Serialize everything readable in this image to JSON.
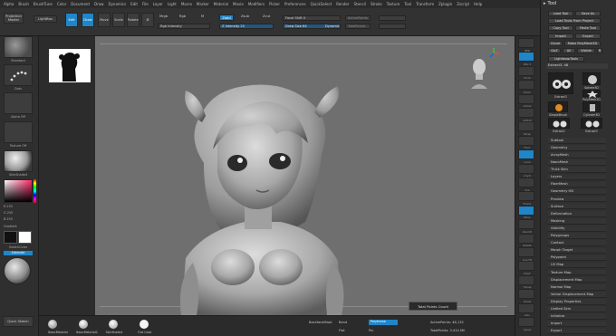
{
  "menu": [
    "Alpha",
    "Brush",
    "BrushTune",
    "Color",
    "Document",
    "Draw",
    "Dynamics",
    "Edit",
    "File",
    "Layer",
    "Light",
    "Macro",
    "Marker",
    "Material",
    "Movie",
    "Modifiers",
    "Picker",
    "Preferences",
    "QuickSelect",
    "Render",
    "Stencil",
    "Stroke",
    "Texture",
    "Tool",
    "Transform",
    "Zplugin",
    "Zscript",
    "Help"
  ],
  "shelf": {
    "projection_master": "Projection Master",
    "lightbox": "LightBox",
    "edit": "Edit",
    "draw": "Draw",
    "move": "Move",
    "scale": "Scale",
    "rotate": "Rotate",
    "mrgb": "Mrgb",
    "rgb": "Rgb",
    "m": "M",
    "zadd": "Zadd",
    "zsub": "Zsub",
    "zcut": "Zcut",
    "rgb_intensity": "Rgb Intensity",
    "z_intensity": "Z Intensity 25",
    "focal_shift": "Focal Shift 0",
    "draw_size": "Draw Size 64",
    "dynamic": "Dynamic",
    "active_points": "ActivePoints",
    "total_points": "TotalPoints"
  },
  "left_tray": {
    "alpha": "Standard",
    "stroke": "Dots",
    "alpha_off": "Alpha Off",
    "texture_off": "Texture Off",
    "material": "SkinShade4",
    "r": "R 255",
    "g": "G 255",
    "b": "B 255",
    "gradient": "Gradient",
    "switch_color": "SwitchColor",
    "alternate": "Alternate",
    "quick_sketch": "Quick Sketch"
  },
  "canvas": {
    "tooltip": "Total Points Count"
  },
  "bottom": {
    "materials": [
      "BasicMaterial",
      "BasicMaterial2",
      "SkinShade4",
      "Flat Color"
    ],
    "backface_mask": "BackfaceMask",
    "bend": "Bend",
    "polyframe": "Polyframe",
    "flat": "Flat",
    "pin": "Pin",
    "active_points": "ActivePoints: 48,132",
    "total_points": "TotalPoints: 3.414 Mil"
  },
  "right_shelf": [
    "BPR",
    "SPix 3",
    "Scroll",
    "Zoom",
    "Actual",
    "AAHalf",
    "Persp",
    "Floor",
    "Local",
    "L.Sym",
    "Xyz",
    "Frame",
    "Move",
    "ZoomD",
    "Rotate",
    "Line Fill",
    "PolyF",
    "Transp",
    "Ghost",
    "Solo",
    "Xpose"
  ],
  "tool": {
    "title": "Tool",
    "load_tool": "Load Tool",
    "save_as": "Save As",
    "load_tools_from_project": "Load Tools From Project",
    "copy_tool": "Copy Tool",
    "paste_tool": "Paste Tool",
    "import": "Import",
    "export": "Export",
    "clone": "Clone",
    "make_polymesh": "Make PolyMesh3D",
    "goz": "GoZ",
    "all": "All",
    "visible": "Visible",
    "r": "R",
    "lightbox_tools": "Lightbox▸Tools",
    "current_tool": "Extract3. 48",
    "subtools": [
      "Extract3",
      "Sphere3D",
      "PolyMesh3D",
      "SimpleBrush",
      "Cylinder3D",
      "Extract2",
      "Extract3"
    ],
    "sections": [
      "Subtool",
      "Geometry",
      "ArrayMesh",
      "NanoMesh",
      "Thick Skin",
      "Layers",
      "FiberMesh",
      "Geometry HD",
      "Preview",
      "Surface",
      "Deformation",
      "Masking",
      "Visibility",
      "Polygroups",
      "Contact",
      "Morph Target",
      "Polypaint",
      "UV Map",
      "Texture Map",
      "Displacement Map",
      "Normal Map",
      "Vector Displacement Map",
      "Display Properties",
      "Unified Skin",
      "Initialize",
      "Import",
      "Export"
    ]
  },
  "colors": {
    "accent": "#1f86c9",
    "canvas": "#6f6f6f",
    "panel": "#303030"
  }
}
